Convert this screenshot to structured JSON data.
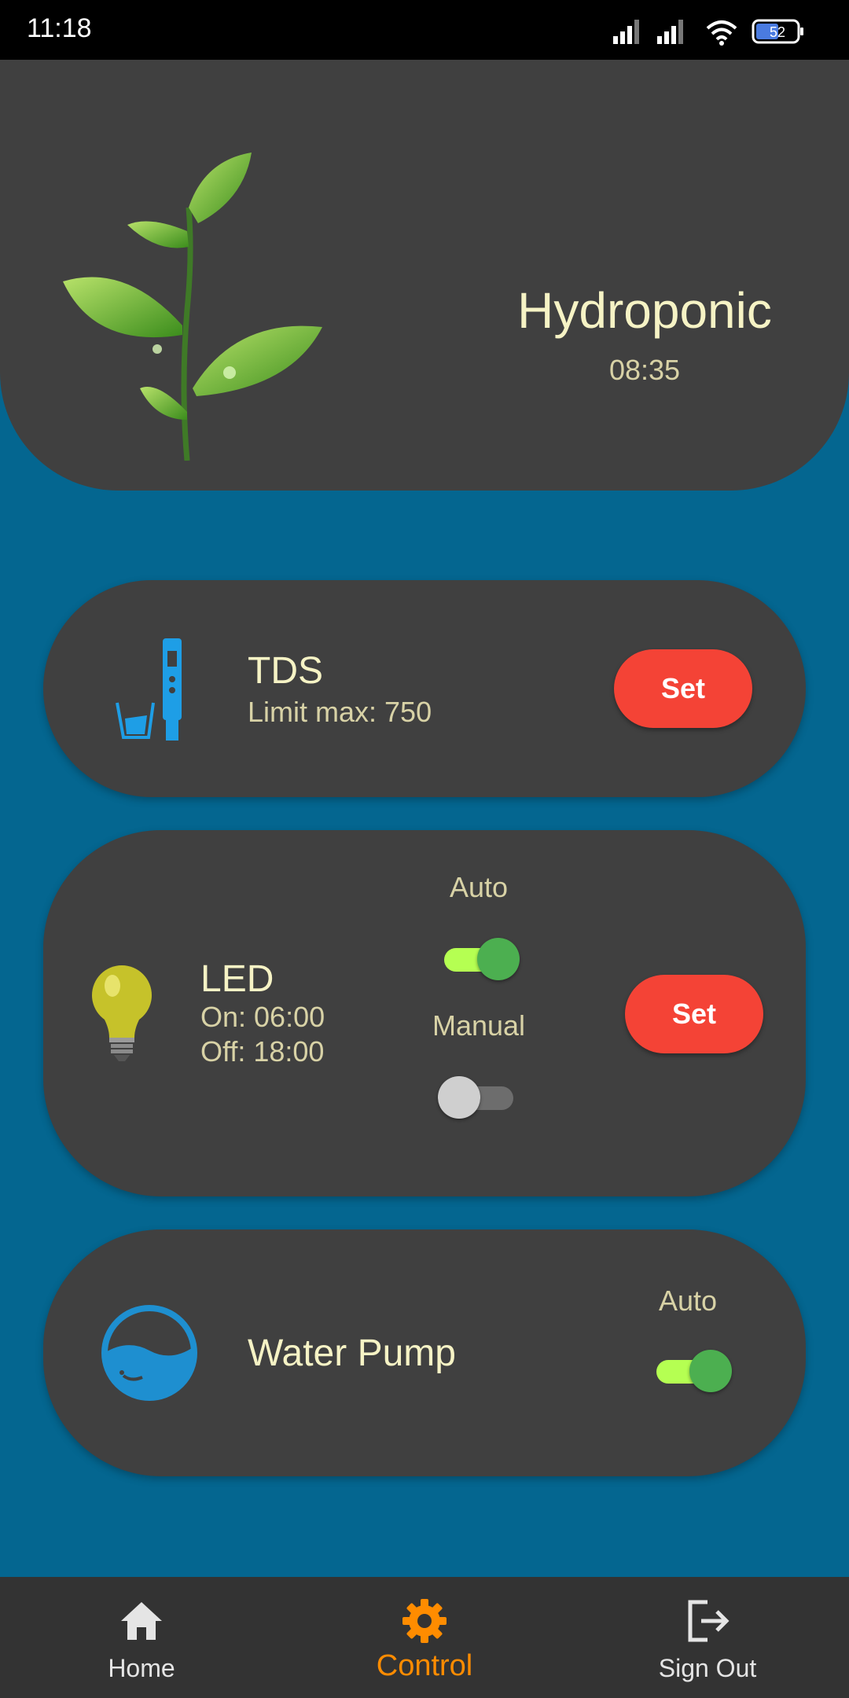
{
  "status_bar": {
    "time": "11:18",
    "battery": "52"
  },
  "header": {
    "title": "Hydroponic",
    "clock": "08:35"
  },
  "tds": {
    "title": "TDS",
    "limit": "Limit max: 750",
    "set_label": "Set"
  },
  "led": {
    "title": "LED",
    "on_time": "On: 06:00",
    "off_time": "Off: 18:00",
    "auto_label": "Auto",
    "auto_on": true,
    "manual_label": "Manual",
    "manual_on": false,
    "set_label": "Set"
  },
  "pump": {
    "title": "Water Pump",
    "auto_label": "Auto",
    "auto_on": true
  },
  "nav": {
    "home": "Home",
    "control": "Control",
    "sign_out": "Sign Out",
    "active": "control"
  },
  "colors": {
    "background": "#046690",
    "card": "#404040",
    "accent": "#ff8c00",
    "set_button": "#f44336",
    "switch_on": "#4caf50"
  }
}
